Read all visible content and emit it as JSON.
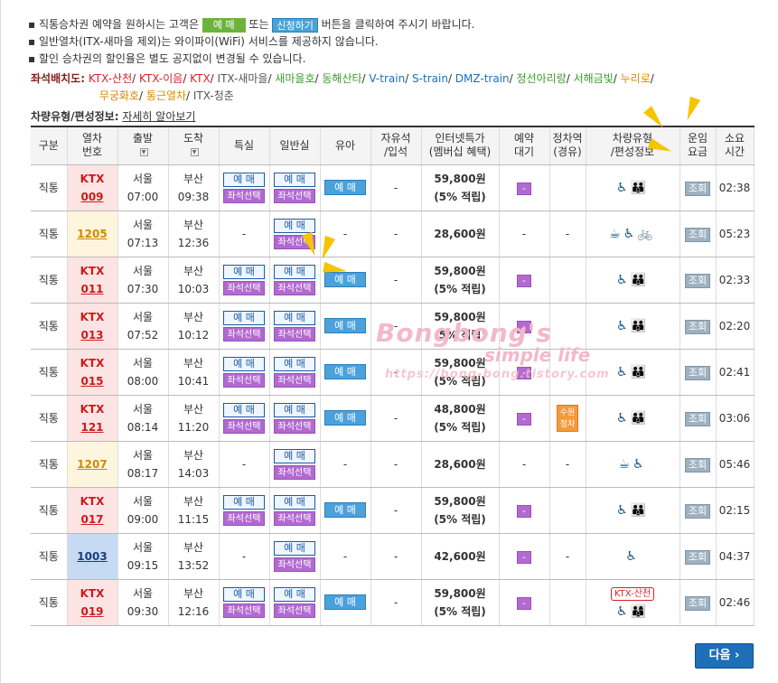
{
  "notes": {
    "line1_a": "직통승차권 예약을 원하시는 고객은",
    "line1_btn1": "예 매",
    "line1_mid": "또는",
    "line1_btn2": "신청하기",
    "line1_b": "버튼을 클릭하여 주시기 바랍니다.",
    "line2": "일반열차(ITX-새마을 제외)는 와이파이(WiFi) 서비스를 제공하지 않습니다.",
    "line3": "할인 승차권의 할인율은 별도 공지없이 변경될 수 있습니다."
  },
  "seatmap": {
    "label": "좌석배치도:",
    "items": [
      "KTX-산천",
      "KTX-이음",
      "KTX",
      "ITX-새마을",
      "새마을호",
      "동해산타",
      "V-train",
      "S-train",
      "DMZ-train",
      "정선아리랑",
      "서해금빛",
      "누리로",
      "무궁화호",
      "통근열차",
      "ITX-청춘"
    ]
  },
  "carinfo": {
    "label": "차량유형/편성정보:",
    "link": "자세히 알아보기"
  },
  "headers": {
    "gubun": "구분",
    "trainno1": "열차",
    "trainno2": "번호",
    "dep": "출발",
    "arr": "도착",
    "special": "특실",
    "general": "일반실",
    "yua": "유아",
    "free1": "자유석",
    "free2": "/입석",
    "net1": "인터넷특가",
    "net2": "(멤버십 혜택)",
    "wait1": "예약",
    "wait2": "대기",
    "stop1": "정차역",
    "stop2": "(경유)",
    "car1": "차량유형",
    "car2": "/편성정보",
    "fare1": "운임",
    "fare2": "요금",
    "dur1": "소요",
    "dur2": "시간"
  },
  "labels": {
    "yemae": "예 매",
    "seat": "좌석선택",
    "yua": "예 매",
    "wait": "-",
    "fare": "조회",
    "dash": "-",
    "stop_badge1": "수원",
    "stop_badge2": "정차",
    "ktx_tag": "KTX-산천"
  },
  "rows": [
    {
      "type": "직통",
      "train1": "KTX",
      "train2": "009",
      "dep_st": "서울",
      "dep_t": "07:00",
      "arr_st": "부산",
      "arr_t": "09:38",
      "fare": "59,800원",
      "fare_sub": "(5% 적립)",
      "dur": "02:38"
    },
    {
      "type": "직통",
      "train1": "",
      "train2": "1205",
      "dep_st": "서울",
      "dep_t": "07:13",
      "arr_st": "부산",
      "arr_t": "12:36",
      "fare": "28,600원",
      "fare_sub": "",
      "dur": "05:23"
    },
    {
      "type": "직통",
      "train1": "KTX",
      "train2": "011",
      "dep_st": "서울",
      "dep_t": "07:30",
      "arr_st": "부산",
      "arr_t": "10:03",
      "fare": "59,800원",
      "fare_sub": "(5% 적립)",
      "dur": "02:33"
    },
    {
      "type": "직통",
      "train1": "KTX",
      "train2": "013",
      "dep_st": "서울",
      "dep_t": "07:52",
      "arr_st": "부산",
      "arr_t": "10:12",
      "fare": "59,800원",
      "fare_sub": "(5% 적립)",
      "dur": "02:20"
    },
    {
      "type": "직통",
      "train1": "KTX",
      "train2": "015",
      "dep_st": "서울",
      "dep_t": "08:00",
      "arr_st": "부산",
      "arr_t": "10:41",
      "fare": "59,800원",
      "fare_sub": "(5% 적립)",
      "dur": "02:41"
    },
    {
      "type": "직통",
      "train1": "KTX",
      "train2": "121",
      "dep_st": "서울",
      "dep_t": "08:14",
      "arr_st": "부산",
      "arr_t": "11:20",
      "fare": "48,800원",
      "fare_sub": "(5% 적립)",
      "dur": "03:06"
    },
    {
      "type": "직통",
      "train1": "",
      "train2": "1207",
      "dep_st": "서울",
      "dep_t": "08:17",
      "arr_st": "부산",
      "arr_t": "14:03",
      "fare": "28,600원",
      "fare_sub": "",
      "dur": "05:46"
    },
    {
      "type": "직통",
      "train1": "KTX",
      "train2": "017",
      "dep_st": "서울",
      "dep_t": "09:00",
      "arr_st": "부산",
      "arr_t": "11:15",
      "fare": "59,800원",
      "fare_sub": "(5% 적립)",
      "dur": "02:15"
    },
    {
      "type": "직통",
      "train1": "",
      "train2": "1003",
      "dep_st": "서울",
      "dep_t": "09:15",
      "arr_st": "부산",
      "arr_t": "13:52",
      "fare": "42,600원",
      "fare_sub": "",
      "dur": "04:37"
    },
    {
      "type": "직통",
      "train1": "KTX",
      "train2": "019",
      "dep_st": "서울",
      "dep_t": "09:30",
      "arr_st": "부산",
      "arr_t": "12:16",
      "fare": "59,800원",
      "fare_sub": "(5% 적립)",
      "dur": "02:46"
    }
  ],
  "next_label": "다음",
  "next_icon": "chevron-right-icon",
  "watermark": {
    "w1": "Bongbong's",
    "w2": "simple life",
    "w3": "https://bong-bong.tistory.com"
  },
  "colors": {
    "ktx": "#cc1b1b",
    "mugunghwa": "#d08a00",
    "itx": "#1a3e7c",
    "seat_btn": "#b26ad1",
    "next_btn": "#1d6fb8"
  }
}
